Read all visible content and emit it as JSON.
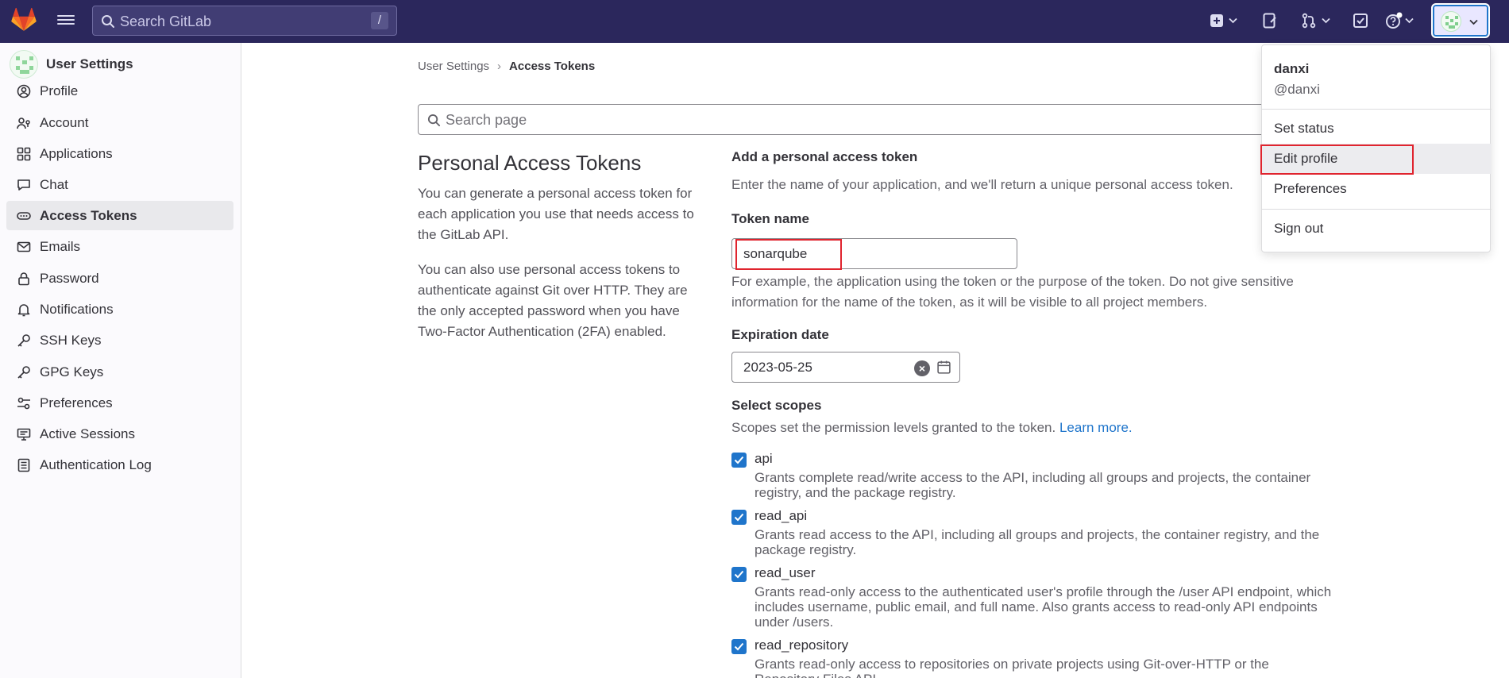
{
  "topbar": {
    "search_placeholder": "Search GitLab",
    "search_shortcut": "/",
    "icons": [
      "new-item-icon",
      "issues-icon",
      "merge-requests-icon",
      "todo-icon",
      "help-icon",
      "user-avatar-icon"
    ]
  },
  "sidebar": {
    "title": "User Settings",
    "items": [
      {
        "label": "Profile",
        "icon": "profile-icon"
      },
      {
        "label": "Account",
        "icon": "account-icon"
      },
      {
        "label": "Applications",
        "icon": "applications-icon"
      },
      {
        "label": "Chat",
        "icon": "chat-icon"
      },
      {
        "label": "Access Tokens",
        "icon": "token-icon",
        "active": true
      },
      {
        "label": "Emails",
        "icon": "email-icon"
      },
      {
        "label": "Password",
        "icon": "lock-icon"
      },
      {
        "label": "Notifications",
        "icon": "bell-icon"
      },
      {
        "label": "SSH Keys",
        "icon": "key-icon"
      },
      {
        "label": "GPG Keys",
        "icon": "key-icon"
      },
      {
        "label": "Preferences",
        "icon": "preferences-icon"
      },
      {
        "label": "Active Sessions",
        "icon": "monitor-icon"
      },
      {
        "label": "Authentication Log",
        "icon": "log-icon"
      }
    ]
  },
  "breadcrumb": {
    "root": "User Settings",
    "separator": "›",
    "current": "Access Tokens"
  },
  "page_search": {
    "placeholder": "Search page"
  },
  "intro": {
    "title": "Personal Access Tokens",
    "p1": "You can generate a personal access token for each application you use that needs access to the GitLab API.",
    "p2": "You can also use personal access tokens to authenticate against Git over HTTP. They are the only accepted password when you have Two-Factor Authentication (2FA) enabled."
  },
  "form": {
    "heading": "Add a personal access token",
    "subheading": "Enter the name of your application, and we'll return a unique personal access token.",
    "token_name_label": "Token name",
    "token_name_value": "sonarqube",
    "token_name_help": "For example, the application using the token or the purpose of the token. Do not give sensitive information for the name of the token, as it will be visible to all project members.",
    "expiration_label": "Expiration date",
    "expiration_value": "2023-05-25",
    "scopes_label": "Select scopes",
    "scopes_help": "Scopes set the permission levels granted to the token.",
    "scopes_link": "Learn more.",
    "scopes": [
      {
        "name": "api",
        "checked": true,
        "desc": "Grants complete read/write access to the API, including all groups and projects, the container registry, and the package registry."
      },
      {
        "name": "read_api",
        "checked": true,
        "desc": "Grants read access to the API, including all groups and projects, the container registry, and the package registry."
      },
      {
        "name": "read_user",
        "checked": true,
        "desc": "Grants read-only access to the authenticated user's profile through the /user API endpoint, which includes username, public email, and full name. Also grants access to read-only API endpoints under /users."
      },
      {
        "name": "read_repository",
        "checked": true,
        "desc": "Grants read-only access to repositories on private projects using Git-over-HTTP or the Repository Files API."
      }
    ]
  },
  "user_menu": {
    "name": "danxi",
    "handle": "@danxi",
    "items": [
      "Set status",
      "Edit profile",
      "Preferences",
      "Sign out"
    ],
    "highlighted": "Edit profile"
  },
  "colors": {
    "topbar": "#2b275c",
    "accent": "#1f75cb",
    "highlight_box": "#e0242e"
  }
}
